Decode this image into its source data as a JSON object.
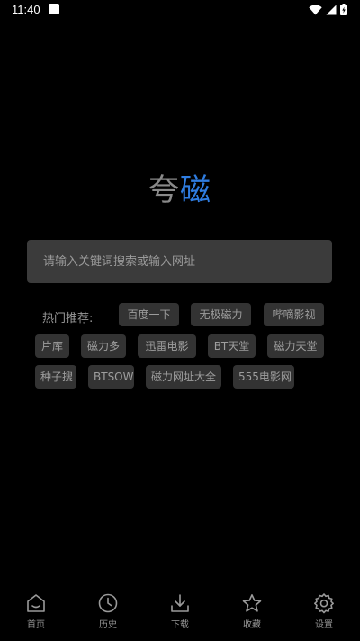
{
  "status_bar": {
    "time": "11:40"
  },
  "logo": {
    "part1": "夸",
    "part2": "磁"
  },
  "search": {
    "placeholder": "请输入关键词搜索或输入网址"
  },
  "hot": {
    "label": "热门推荐:",
    "tags": [
      "百度一下",
      "无极磁力",
      "哔嘀影视",
      "片库",
      "磁力多",
      "迅雷电影",
      "BT天堂",
      "磁力天堂",
      "种子搜",
      "BTSOW",
      "磁力网址大全",
      "555电影网"
    ]
  },
  "nav": {
    "items": [
      {
        "label": "首页",
        "icon": "home-icon"
      },
      {
        "label": "历史",
        "icon": "clock-icon"
      },
      {
        "label": "下载",
        "icon": "download-icon"
      },
      {
        "label": "收藏",
        "icon": "star-icon"
      },
      {
        "label": "设置",
        "icon": "gear-icon"
      }
    ]
  },
  "colors": {
    "background": "#000000",
    "logo_grey": "#8a8a8a",
    "logo_blue": "#2f7de1",
    "search_bg": "#3b3b3b",
    "tag_bg": "#333333"
  }
}
